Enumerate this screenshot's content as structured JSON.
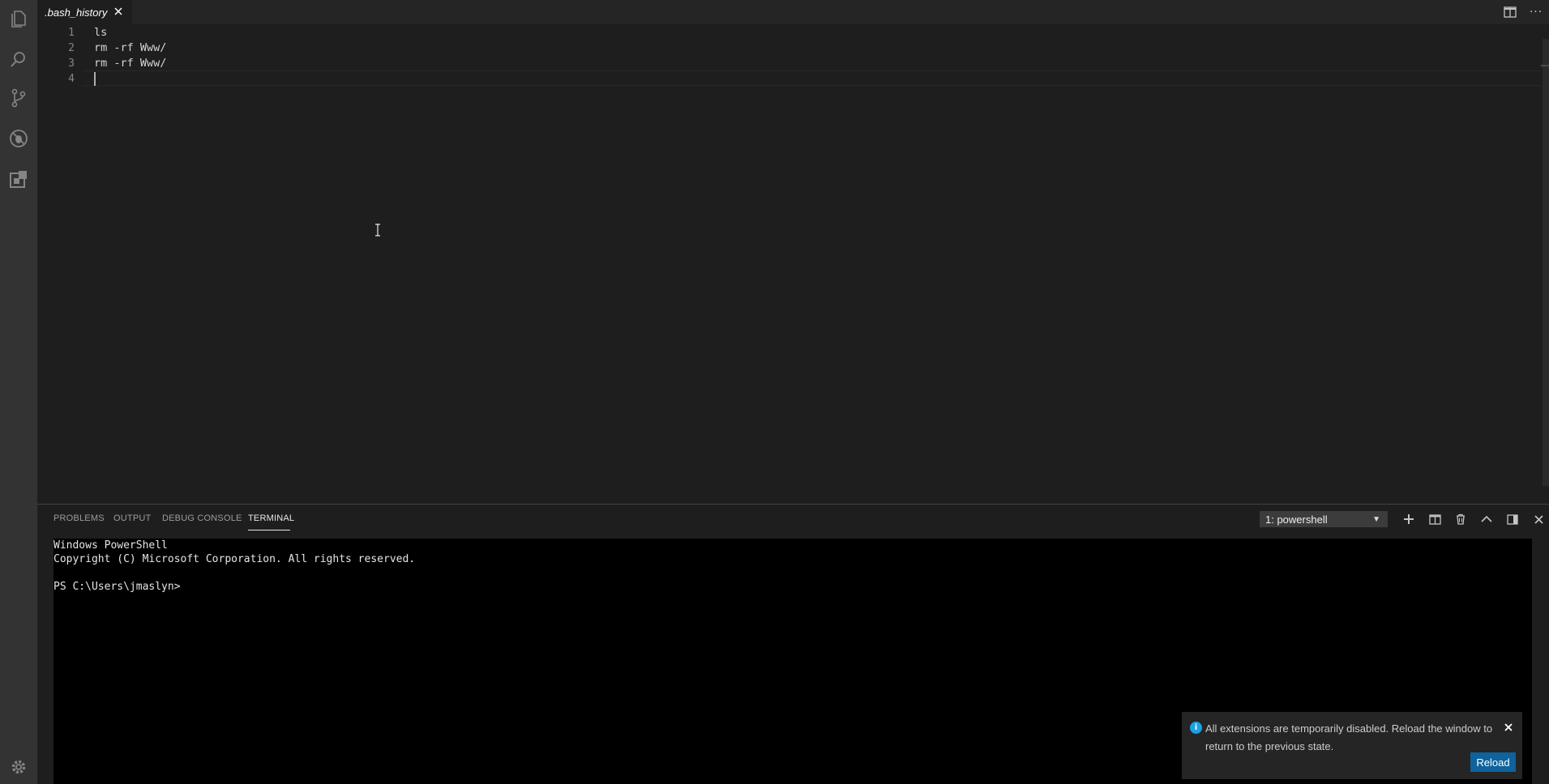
{
  "activity_bar": {
    "items": [
      {
        "name": "explorer-icon"
      },
      {
        "name": "search-icon"
      },
      {
        "name": "source-control-icon"
      },
      {
        "name": "debug-icon"
      },
      {
        "name": "extensions-icon"
      }
    ],
    "bottom": {
      "name": "gear-icon"
    }
  },
  "editor": {
    "tab": {
      "title": ".bash_history",
      "close_icon": "close-icon"
    },
    "actions": [
      {
        "name": "split-editor-icon"
      },
      {
        "name": "more-actions-icon",
        "glyph": "···"
      }
    ],
    "lines": [
      {
        "num": "1",
        "text": "ls"
      },
      {
        "num": "2",
        "text": "rm -rf Www/"
      },
      {
        "num": "3",
        "text": "rm -rf Www/"
      },
      {
        "num": "4",
        "text": ""
      }
    ]
  },
  "panel": {
    "tabs": [
      {
        "label": "PROBLEMS",
        "active": false
      },
      {
        "label": "OUTPUT",
        "active": false
      },
      {
        "label": "DEBUG CONSOLE",
        "active": false
      },
      {
        "label": "TERMINAL",
        "active": true
      }
    ],
    "terminal_select": {
      "value": "1: powershell"
    },
    "actions": [
      {
        "name": "new-terminal-icon"
      },
      {
        "name": "split-terminal-icon"
      },
      {
        "name": "kill-terminal-icon"
      },
      {
        "name": "maximize-panel-icon"
      },
      {
        "name": "toggle-panel-position-icon"
      },
      {
        "name": "close-panel-icon"
      }
    ],
    "terminal_lines": [
      "Windows PowerShell",
      "Copyright (C) Microsoft Corporation. All rights reserved.",
      "",
      "PS C:\\Users\\jmaslyn>"
    ]
  },
  "notification": {
    "icon": "info-icon",
    "icon_glyph": "i",
    "message": "All extensions are temporarily disabled. Reload the window to return to the previous state.",
    "button_label": "Reload"
  },
  "colors": {
    "activity_bar": "#333333",
    "editor_bg": "#1e1e1e",
    "terminal_bg": "#000000",
    "accent_button": "#0e639c",
    "info": "#1ba1e2"
  }
}
